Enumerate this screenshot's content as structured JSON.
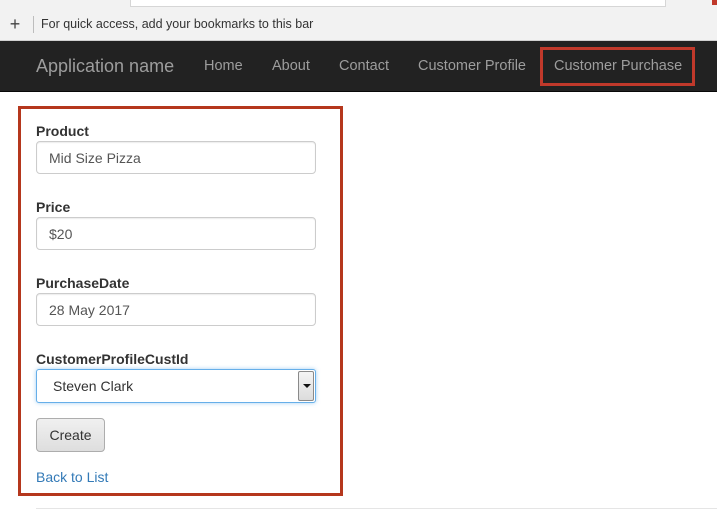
{
  "browser": {
    "bookmarks_message": "For quick access, add your bookmarks to this bar"
  },
  "navbar": {
    "brand": "Application name",
    "links": [
      {
        "label": "Home"
      },
      {
        "label": "About"
      },
      {
        "label": "Contact"
      },
      {
        "label": "Customer Profile"
      },
      {
        "label": "Customer Purchase"
      }
    ],
    "active_link": "Customer Purchase"
  },
  "form": {
    "product": {
      "label": "Product",
      "value": "Mid Size Pizza"
    },
    "price": {
      "label": "Price",
      "value": "$20"
    },
    "purchase_date": {
      "label": "PurchaseDate",
      "value": "28 May 2017"
    },
    "customer": {
      "label": "CustomerProfileCustId",
      "selected": "Steven Clark"
    },
    "create_button": "Create",
    "back_link": "Back to List"
  },
  "colors": {
    "navbar_bg": "#222222",
    "nav_text": "#9d9d9d",
    "highlight_border": "#c0392b",
    "link": "#337ab7"
  },
  "icons": {
    "new_tab": "plus-icon",
    "dropdown": "chevron-down-icon"
  }
}
